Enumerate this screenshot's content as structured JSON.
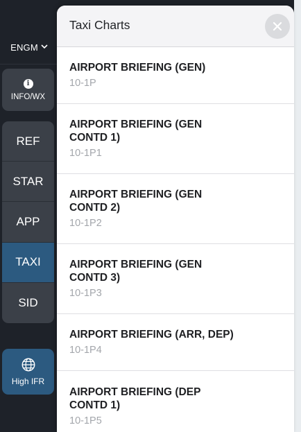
{
  "sidebar": {
    "airport": "ENGM",
    "info_label": "INFO/WX",
    "tabs": [
      "REF",
      "STAR",
      "APP",
      "TAXI",
      "SID"
    ],
    "active_tab": "TAXI",
    "ifr_label": "High IFR"
  },
  "panel": {
    "title": "Taxi Charts",
    "items": [
      {
        "title": "AIRPORT BRIEFING (GEN)",
        "code": "10-1P"
      },
      {
        "title": "AIRPORT BRIEFING (GEN CONTD 1)",
        "code": "10-1P1"
      },
      {
        "title": "AIRPORT BRIEFING (GEN CONTD 2)",
        "code": "10-1P2"
      },
      {
        "title": "AIRPORT BRIEFING (GEN CONTD 3)",
        "code": "10-1P3"
      },
      {
        "title": "AIRPORT BRIEFING (ARR, DEP)",
        "code": "10-1P4"
      },
      {
        "title": "AIRPORT BRIEFING (DEP CONTD 1)",
        "code": "10-1P5"
      }
    ]
  },
  "colors": {
    "sidebar_bg": "#1e2229",
    "button_bg": "#3b4048",
    "active_blue": "#2c5a80",
    "panel_header_bg": "#f4f4f6",
    "code_gray": "#a3a6ab"
  },
  "icons": {
    "info": "info-icon",
    "globe": "globe-icon",
    "close": "close-icon",
    "dropdown": "chevron-down-icon"
  }
}
